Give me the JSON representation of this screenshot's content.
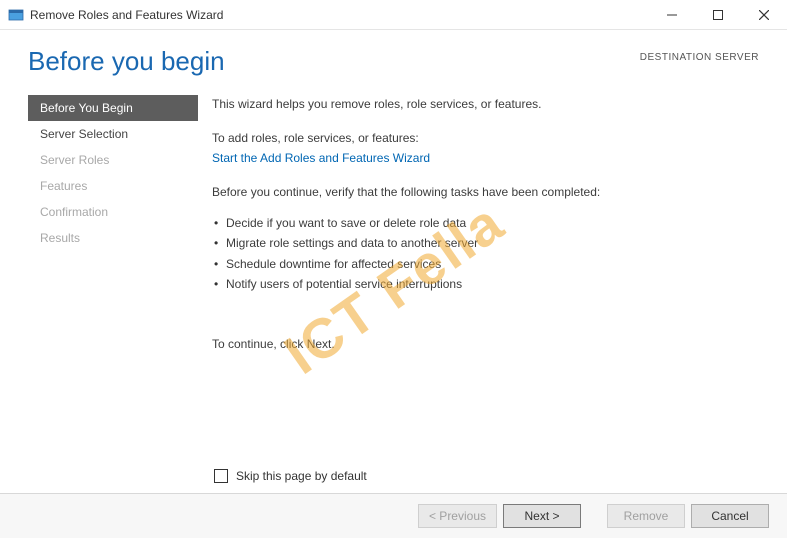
{
  "window": {
    "title": "Remove Roles and Features Wizard"
  },
  "header": {
    "page_title": "Before you begin",
    "destination_label": "DESTINATION SERVER"
  },
  "sidebar": {
    "items": [
      {
        "label": "Before You Begin",
        "state": "active"
      },
      {
        "label": "Server Selection",
        "state": "enabled"
      },
      {
        "label": "Server Roles",
        "state": "disabled"
      },
      {
        "label": "Features",
        "state": "disabled"
      },
      {
        "label": "Confirmation",
        "state": "disabled"
      },
      {
        "label": "Results",
        "state": "disabled"
      }
    ]
  },
  "content": {
    "intro": "This wizard helps you remove roles, role services, or features.",
    "add_prompt": "To add roles, role services, or features:",
    "add_link": "Start the Add Roles and Features Wizard",
    "verify_prompt": "Before you continue, verify that the following tasks have been completed:",
    "bullets": [
      "Decide if you want to save or delete role data",
      "Migrate role settings and data to another server",
      "Schedule downtime for affected services",
      "Notify users of potential service interruptions"
    ],
    "continue": "To continue, click Next."
  },
  "skip": {
    "label": "Skip this page by default",
    "checked": false
  },
  "footer": {
    "previous": "< Previous",
    "next": "Next >",
    "remove": "Remove",
    "cancel": "Cancel"
  },
  "watermark": "ICT Fella"
}
